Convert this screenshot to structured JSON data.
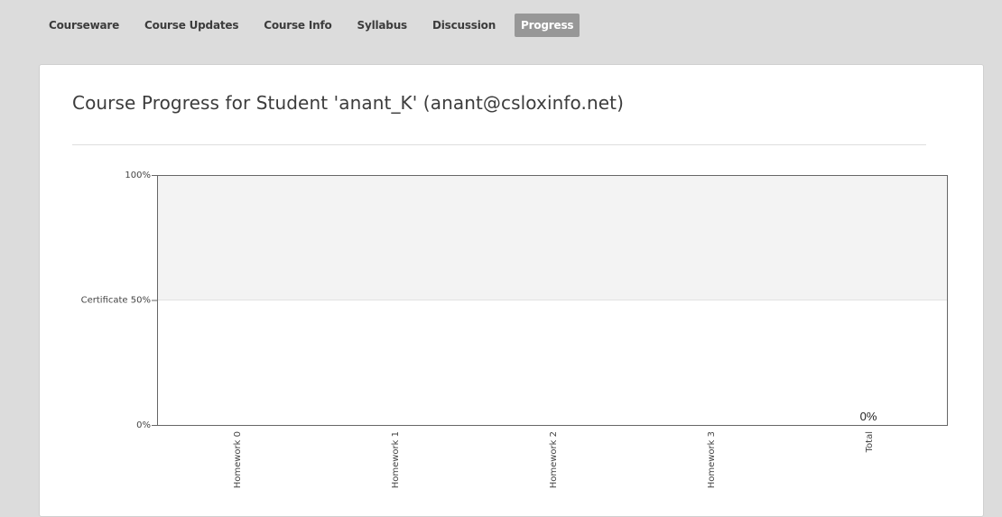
{
  "nav": {
    "tabs": [
      {
        "label": "Courseware"
      },
      {
        "label": "Course Updates"
      },
      {
        "label": "Course Info"
      },
      {
        "label": "Syllabus"
      },
      {
        "label": "Discussion"
      },
      {
        "label": "Progress",
        "active": true
      }
    ]
  },
  "page": {
    "title": "Course Progress for Student 'anant_K' (anant@csloxinfo.net)"
  },
  "colors": {
    "certificate_band": "#f3f3f3",
    "active_tab": "#979797"
  },
  "chart_data": {
    "type": "bar",
    "categories": [
      "Homework 0",
      "Homework 1",
      "Homework 2",
      "Homework 3",
      "Total"
    ],
    "values": [
      0,
      0,
      0,
      0,
      0
    ],
    "ylim": [
      0,
      100
    ],
    "yticks": [
      {
        "value": 0,
        "label": "0%"
      },
      {
        "value": 50,
        "label": "Certificate 50%"
      },
      {
        "value": 100,
        "label": "100%"
      }
    ],
    "data_labels": [
      {
        "category": "Total",
        "label": "0%"
      }
    ],
    "certificate_threshold": 50,
    "grid": false
  }
}
